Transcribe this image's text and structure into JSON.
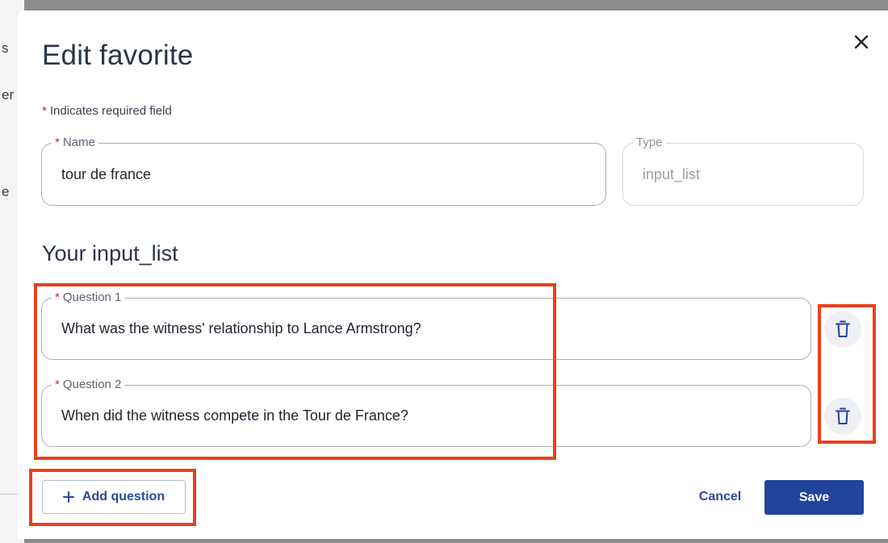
{
  "background": {
    "fragments": [
      "s",
      "er",
      "e"
    ]
  },
  "modal": {
    "title": "Edit favorite",
    "close_icon": "close-icon",
    "required_star": "*",
    "required_note": "Indicates required field"
  },
  "fields": {
    "name": {
      "label": "Name",
      "required": true,
      "value": "tour de france"
    },
    "type": {
      "label": "Type",
      "required": false,
      "value": "input_list",
      "disabled": true
    }
  },
  "section": {
    "title": "Your input_list"
  },
  "questions": [
    {
      "label": "Question 1",
      "required": true,
      "value": "What was the witness' relationship to Lance Armstrong?",
      "delete_icon": "trash-icon"
    },
    {
      "label": "Question 2",
      "required": true,
      "value": "When did the witness compete in the Tour de France?",
      "delete_icon": "trash-icon"
    }
  ],
  "footer": {
    "add_icon": "plus-icon",
    "add_label": "Add question",
    "cancel_label": "Cancel",
    "save_label": "Save"
  },
  "colors": {
    "primary": "#22449a",
    "link": "#2a4a9a",
    "required": "#c62828",
    "highlight": "#e8411c",
    "overlay": "#8c8c8c"
  }
}
